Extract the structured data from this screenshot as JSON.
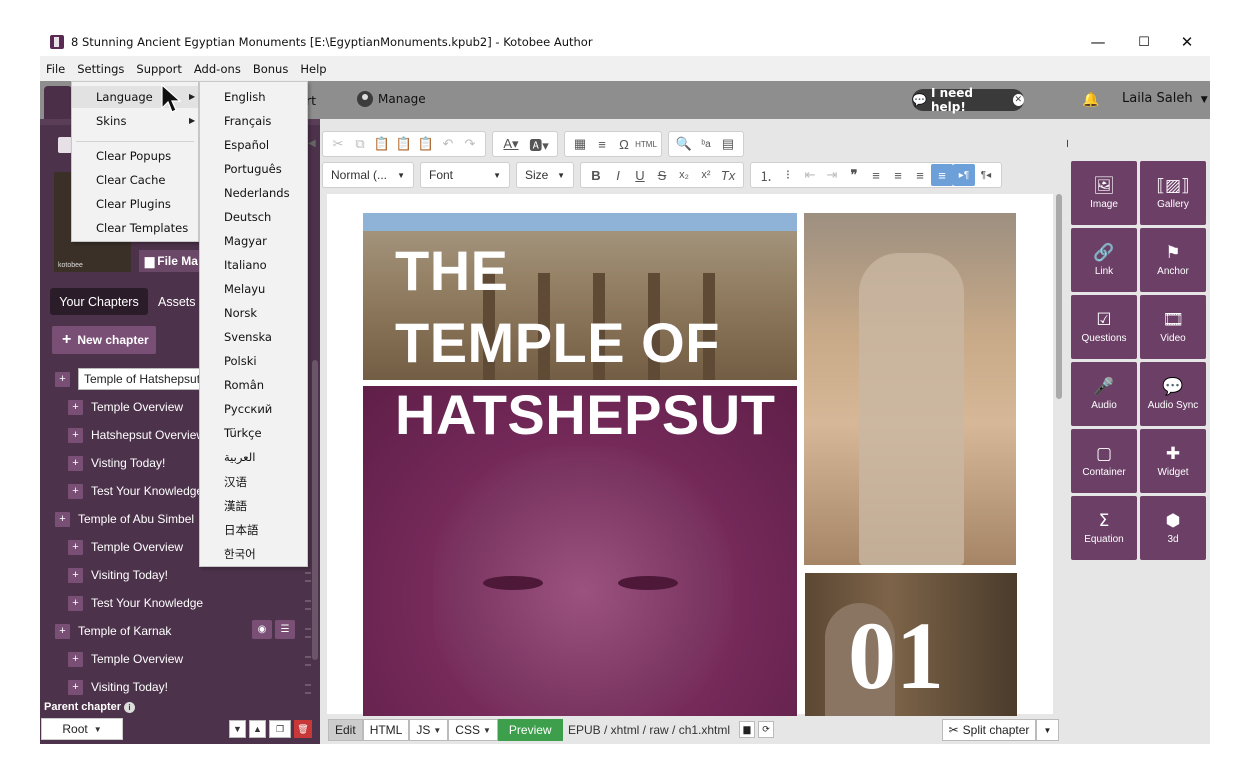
{
  "window": {
    "title": "8 Stunning Ancient Egyptian Monuments [E:\\EgyptianMonuments.kpub2] - Kotobee Author",
    "minimize": "—",
    "maximize": "☐",
    "close": "✕"
  },
  "menubar": {
    "items": [
      "File",
      "Settings",
      "Support",
      "Add-ons",
      "Bonus",
      "Help"
    ]
  },
  "header": {
    "partial_tab": "rt",
    "manage": "Manage",
    "help": "I need help!",
    "user": "Laila Saleh"
  },
  "settings_menu": {
    "language": "Language",
    "skins": "Skins",
    "clear_popups": "Clear Popups",
    "clear_cache": "Clear Cache",
    "clear_plugins": "Clear Plugins",
    "clear_templates": "Clear Templates"
  },
  "languages": [
    "English",
    "Français",
    "Español",
    "Português",
    "Nederlands",
    "Deutsch",
    "Magyar",
    "Italiano",
    "Melayu",
    "Norsk",
    "Svenska",
    "Polski",
    "Român",
    "Русский",
    "Türkçe",
    "العربية",
    "汉语",
    "漢語",
    "日本語",
    "한국어"
  ],
  "sidebar": {
    "file_manager": "File Ma",
    "cover_brand": "kotobee",
    "tab_chapters": "Your Chapters",
    "tab_assets": "Assets",
    "new_chapter": "New chapter",
    "editing_chapter": "Temple of Hatshepsut",
    "chapters": [
      {
        "label": "Temple Overview",
        "level": 1
      },
      {
        "label": "Hatshepsut Overview",
        "level": 1
      },
      {
        "label": "Visting Today!",
        "level": 1
      },
      {
        "label": "Test Your Knowledge",
        "level": 1
      },
      {
        "label": "Temple of Abu Simbel",
        "level": 0
      },
      {
        "label": "Temple Overview",
        "level": 1
      },
      {
        "label": "Visiting Today!",
        "level": 1
      },
      {
        "label": "Test Your Knowledge",
        "level": 1
      },
      {
        "label": "Temple of Karnak",
        "level": 0
      },
      {
        "label": "Temple Overview",
        "level": 1
      },
      {
        "label": "Visiting Today!",
        "level": 1
      }
    ],
    "parent_chapter": "Parent chapter",
    "root": "Root"
  },
  "toolbar": {
    "normal": "Normal (...",
    "font": "Font",
    "size": "Size"
  },
  "page": {
    "title_lines": [
      "THE",
      "TEMPLE OF",
      "HATSHEPSUT"
    ],
    "number": "01"
  },
  "bottom": {
    "edit": "Edit",
    "html": "HTML",
    "js": "JS",
    "css": "CSS",
    "preview": "Preview",
    "path": "EPUB / xhtml / raw / ch1.xhtml",
    "split": "Split chapter"
  },
  "right_panel": [
    {
      "label": "Image",
      "icon": "image-icon"
    },
    {
      "label": "Gallery",
      "icon": "gallery-icon"
    },
    {
      "label": "Link",
      "icon": "link-icon"
    },
    {
      "label": "Anchor",
      "icon": "anchor-flag-icon"
    },
    {
      "label": "Questions",
      "icon": "checkbox-icon"
    },
    {
      "label": "Video",
      "icon": "film-icon"
    },
    {
      "label": "Audio",
      "icon": "microphone-icon"
    },
    {
      "label": "Audio Sync",
      "icon": "speech-bubbles-icon"
    },
    {
      "label": "Container",
      "icon": "square-icon"
    },
    {
      "label": "Widget",
      "icon": "puzzle-icon"
    },
    {
      "label": "Equation",
      "icon": "sigma-icon"
    },
    {
      "label": "3d",
      "icon": "cube-icon"
    }
  ],
  "colors": {
    "sidebar": "#4c324a",
    "accent": "#6b3f66",
    "preview": "#3d9e4c"
  }
}
